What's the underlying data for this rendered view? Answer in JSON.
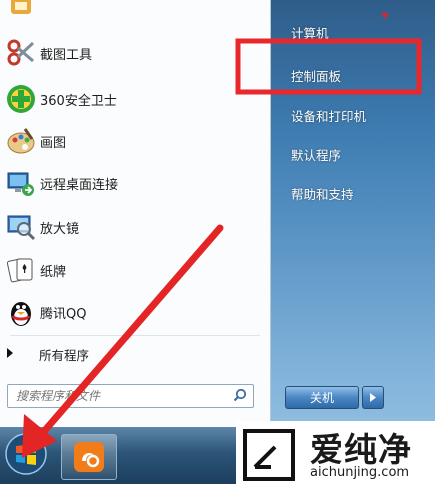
{
  "start_menu": {
    "pinned_items": [
      {
        "label": "截图工具",
        "icon": "scissors-icon"
      },
      {
        "label": "360安全卫士",
        "icon": "shield-cross-icon"
      },
      {
        "label": "画图",
        "icon": "palette-icon"
      },
      {
        "label": "远程桌面连接",
        "icon": "remote-desktop-icon"
      },
      {
        "label": "放大镜",
        "icon": "magnifier-icon"
      },
      {
        "label": "纸牌",
        "icon": "cards-icon"
      },
      {
        "label": "腾讯QQ",
        "icon": "penguin-icon"
      }
    ],
    "all_programs": "所有程序",
    "search_placeholder": "搜索程序和文件",
    "right_links": [
      "计算机",
      "控制面板",
      "设备和打印机",
      "默认程序",
      "帮助和支持"
    ],
    "shutdown_label": "关机"
  },
  "watermark": {
    "brand": "爱纯净",
    "url": "aichunjing.com"
  },
  "colors": {
    "highlight_box": "#e8282c",
    "arrow": "#e32525",
    "panel_top": "#2f5d8a",
    "panel_bottom": "#8fbde0"
  }
}
